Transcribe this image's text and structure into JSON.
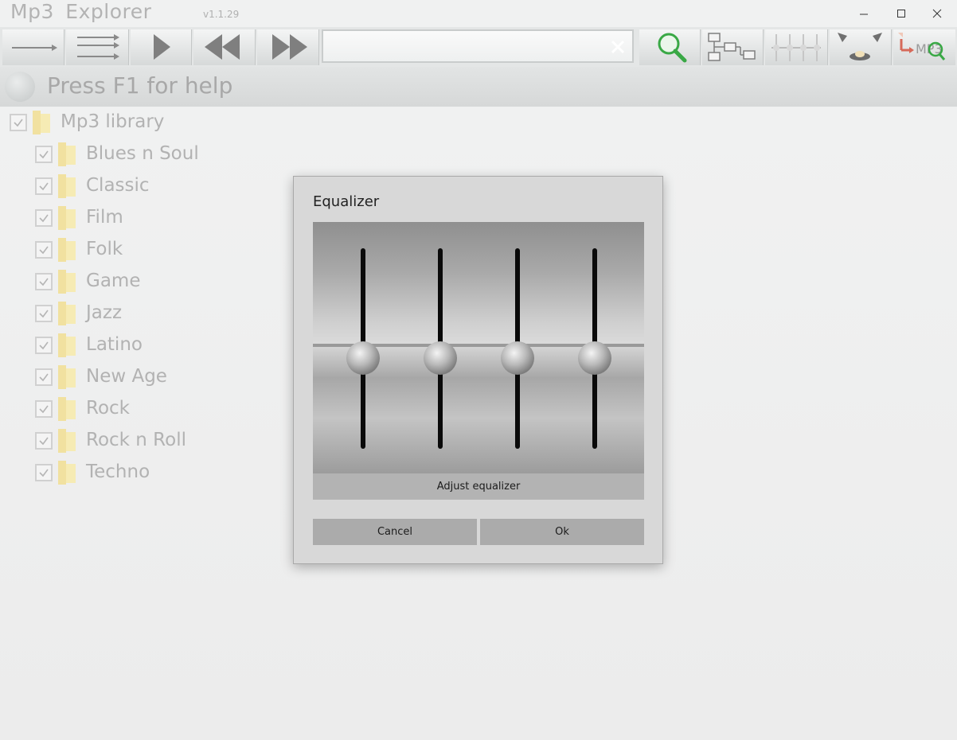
{
  "app": {
    "title": "Mp3 Explorer",
    "version": "v1.1.29"
  },
  "window_controls": [
    "minimize-icon",
    "maximize-icon",
    "close-icon"
  ],
  "toolbar": {
    "buttons": [
      {
        "name": "play-single-button",
        "icon": "arrow-right-icon"
      },
      {
        "name": "play-all-button",
        "icon": "double-arrow-right-icon"
      },
      {
        "name": "play-button",
        "icon": "play-icon"
      },
      {
        "name": "previous-button",
        "icon": "rewind-icon"
      },
      {
        "name": "next-button",
        "icon": "fast-forward-icon"
      },
      {
        "name": "search-button",
        "icon": "magnifier-icon"
      },
      {
        "name": "tree-view-button",
        "icon": "tree-icon"
      },
      {
        "name": "equalizer-button",
        "icon": "equalizer-icon"
      },
      {
        "name": "speaker-button",
        "icon": "speaker-icon"
      },
      {
        "name": "mp3-tag-button",
        "icon": "mp3-search-icon"
      }
    ],
    "search": {
      "value": "",
      "placeholder": ""
    },
    "mp3_badge": "MP3"
  },
  "help": {
    "text": "Press F1 for help"
  },
  "tree": {
    "root": "Mp3 library",
    "items": [
      "Blues n Soul",
      "Classic",
      "Film",
      "Folk",
      "Game",
      "Jazz",
      "Latino",
      "New Age",
      "Rock",
      "Rock n Roll",
      "Techno"
    ]
  },
  "dialog": {
    "title": "Equalizer",
    "caption": "Adjust equalizer",
    "cancel_label": "Cancel",
    "ok_label": "Ok",
    "sliders": [
      {
        "name": "band-1",
        "value": 0.5
      },
      {
        "name": "band-2",
        "value": 0.5
      },
      {
        "name": "band-3",
        "value": 0.5
      },
      {
        "name": "band-4",
        "value": 0.5
      }
    ]
  },
  "colors": {
    "accent_green": "#39a845",
    "folder_yellow": "#f3e39a",
    "dialog_bg": "#d8d8d8"
  }
}
